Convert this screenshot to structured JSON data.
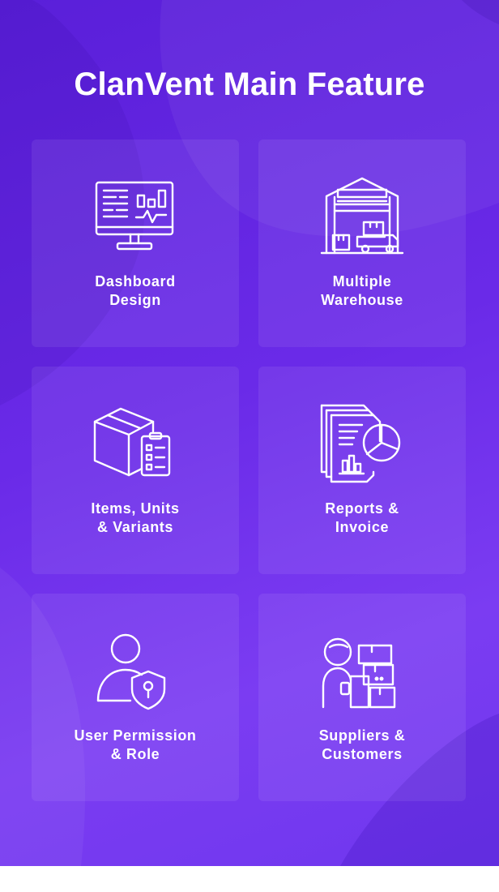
{
  "title": "ClanVent Main Feature",
  "colors": {
    "background": "#6a2ae8",
    "card": "#7a45ee",
    "text": "#ffffff"
  },
  "features": [
    {
      "icon": "monitor-dashboard-icon",
      "line1": "Dashboard",
      "line2": "Design"
    },
    {
      "icon": "warehouse-icon",
      "line1": "Multiple",
      "line2": "Warehouse"
    },
    {
      "icon": "box-checklist-icon",
      "line1": "Items, Units",
      "line2": "& Variants"
    },
    {
      "icon": "report-document-icon",
      "line1": "Reports &",
      "line2": "Invoice"
    },
    {
      "icon": "user-shield-icon",
      "line1": "User Permission",
      "line2": "& Role"
    },
    {
      "icon": "supplier-boxes-icon",
      "line1": "Suppliers &",
      "line2": "Customers"
    }
  ]
}
